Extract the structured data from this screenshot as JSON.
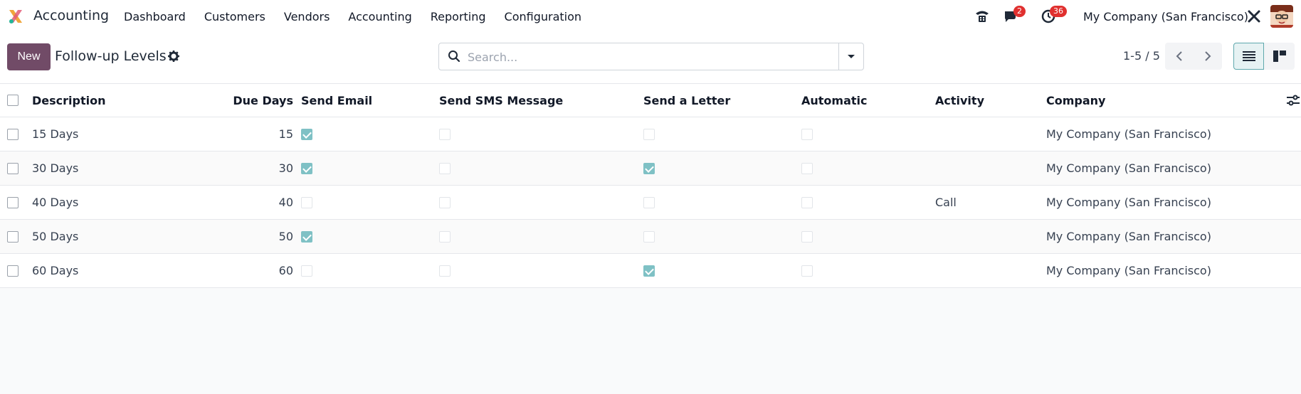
{
  "app": {
    "name": "Accounting"
  },
  "menu": [
    "Dashboard",
    "Customers",
    "Vendors",
    "Accounting",
    "Reporting",
    "Configuration"
  ],
  "systray": {
    "messages_count": "2",
    "activities_count": "36",
    "company": "My Company (San Francisco)"
  },
  "control": {
    "new_label": "New",
    "title": "Follow-up Levels",
    "search_placeholder": "Search...",
    "pager": "1-5 / 5"
  },
  "table": {
    "columns": [
      "Description",
      "Due Days",
      "Send Email",
      "Send SMS Message",
      "Send a Letter",
      "Automatic",
      "Activity",
      "Company"
    ],
    "rows": [
      {
        "description": "15 Days",
        "due_days": "15",
        "send_email": true,
        "send_sms": false,
        "send_letter": false,
        "automatic": false,
        "activity": "",
        "company": "My Company (San Francisco)"
      },
      {
        "description": "30 Days",
        "due_days": "30",
        "send_email": true,
        "send_sms": false,
        "send_letter": true,
        "automatic": false,
        "activity": "",
        "company": "My Company (San Francisco)"
      },
      {
        "description": "40 Days",
        "due_days": "40",
        "send_email": false,
        "send_sms": false,
        "send_letter": false,
        "automatic": false,
        "activity": "Call",
        "company": "My Company (San Francisco)"
      },
      {
        "description": "50 Days",
        "due_days": "50",
        "send_email": true,
        "send_sms": false,
        "send_letter": false,
        "automatic": false,
        "activity": "",
        "company": "My Company (San Francisco)"
      },
      {
        "description": "60 Days",
        "due_days": "60",
        "send_email": false,
        "send_sms": false,
        "send_letter": true,
        "automatic": false,
        "activity": "",
        "company": "My Company (San Francisco)"
      }
    ]
  },
  "colors": {
    "brand": "#714b67",
    "checked": "#7fc1c5",
    "badge": "#e0302f"
  },
  "icons": [
    "app-logo-icon",
    "phone-icon",
    "chat-icon",
    "clock-icon",
    "tools-icon",
    "gear-icon",
    "search-icon",
    "caret-down-icon",
    "chevron-left-icon",
    "chevron-right-icon",
    "list-view-icon",
    "kanban-view-icon",
    "optional-columns-icon"
  ]
}
